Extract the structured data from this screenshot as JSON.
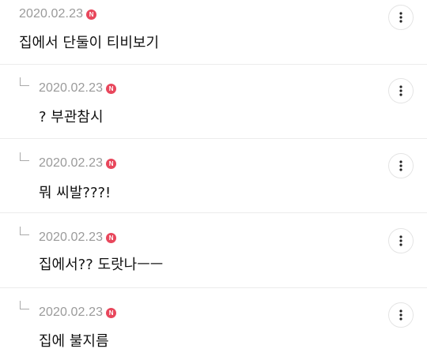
{
  "comments": [
    {
      "date": "2020.02.23",
      "badge": "N",
      "text": "집에서 단둘이 티비보기",
      "is_reply": false
    },
    {
      "date": "2020.02.23",
      "badge": "N",
      "text": "? 부관참시",
      "is_reply": true
    },
    {
      "date": "2020.02.23",
      "badge": "N",
      "text": "뭐 씨발???!",
      "is_reply": true
    },
    {
      "date": "2020.02.23",
      "badge": "N",
      "text": "집에서?? 도랏나ㅡㅡ",
      "is_reply": true
    },
    {
      "date": "2020.02.23",
      "badge": "N",
      "text": "집에 불지름",
      "is_reply": true
    }
  ],
  "colors": {
    "badge": "#e8475c",
    "date": "#9a9a9a",
    "text": "#111111",
    "divider": "#ececec"
  },
  "icons": {
    "more": "more-vertical-icon",
    "reply": "reply-arrow-icon",
    "badge": "new-badge-icon"
  }
}
